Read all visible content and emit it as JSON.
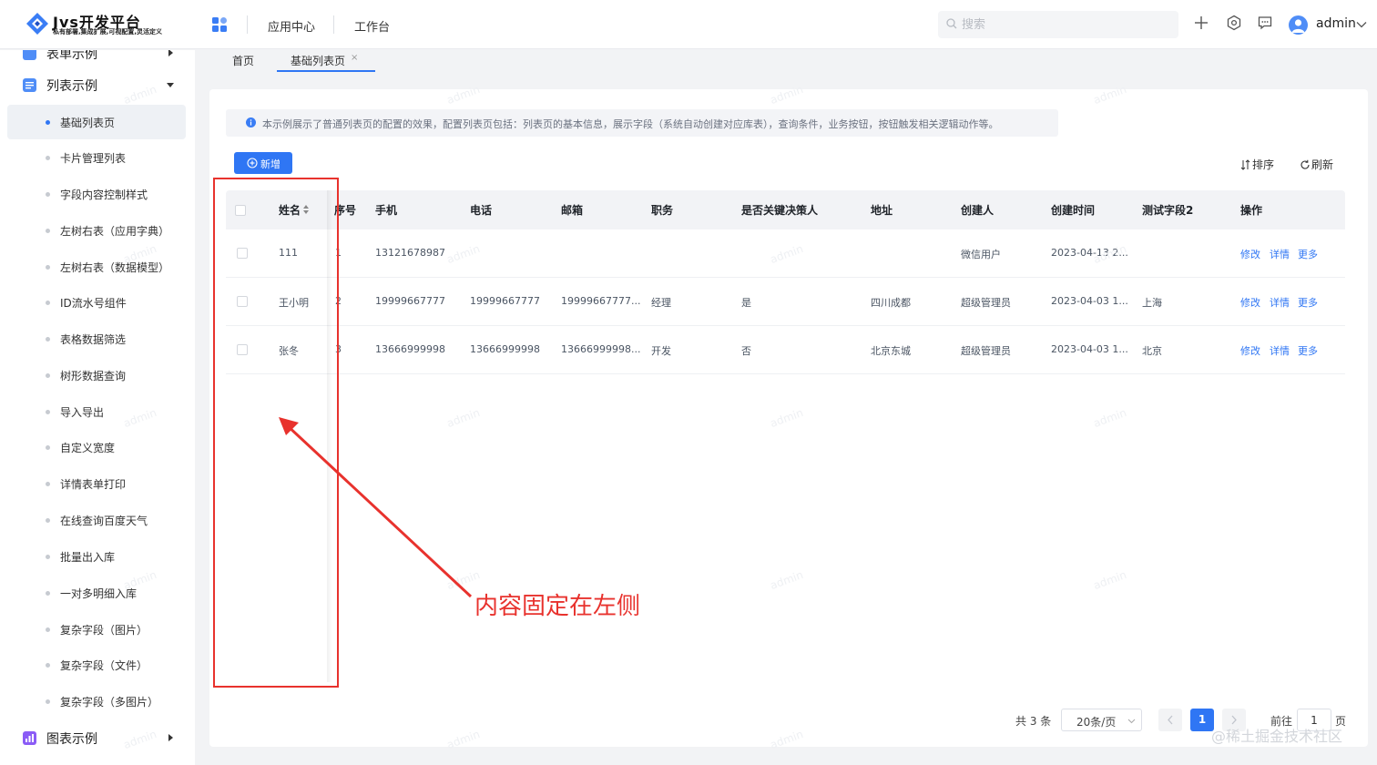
{
  "header": {
    "logo_title": "Jvs开发平台",
    "logo_subtitle": "私有部署,集成扩展,可视配置,灵活定义",
    "nav": [
      "应用中心",
      "工作台"
    ],
    "search_placeholder": "搜索",
    "username": "admin",
    "icons": [
      "apps-grid-icon",
      "plus-icon",
      "settings-icon",
      "message-icon",
      "user-avatar-icon",
      "chevron-down-icon"
    ]
  },
  "sidebar": {
    "groups": [
      {
        "label": "表单示例",
        "icon": "form-icon",
        "expanded": false
      },
      {
        "label": "列表示例",
        "icon": "list-icon",
        "expanded": true
      },
      {
        "label": "图表示例",
        "icon": "chart-icon",
        "expanded": false
      }
    ],
    "items": [
      {
        "label": "基础列表页",
        "active": true
      },
      {
        "label": "卡片管理列表"
      },
      {
        "label": "字段内容控制样式"
      },
      {
        "label": "左树右表（应用字典）"
      },
      {
        "label": "左树右表（数据模型）"
      },
      {
        "label": "ID流水号组件"
      },
      {
        "label": "表格数据筛选"
      },
      {
        "label": "树形数据查询"
      },
      {
        "label": "导入导出"
      },
      {
        "label": "自定义宽度"
      },
      {
        "label": "详情表单打印"
      },
      {
        "label": "在线查询百度天气"
      },
      {
        "label": "批量出入库"
      },
      {
        "label": "一对多明细入库"
      },
      {
        "label": "复杂字段（图片）"
      },
      {
        "label": "复杂字段（文件）"
      },
      {
        "label": "复杂字段（多图片）"
      }
    ]
  },
  "tabs": [
    {
      "label": "首页",
      "active": false
    },
    {
      "label": "基础列表页",
      "active": true,
      "closable": true
    }
  ],
  "notice": "本示例展示了普通列表页的配置的效果，配置列表页包括：列表页的基本信息，展示字段（系统自动创建对应库表），查询条件，业务按钮，按钮触发相关逻辑动作等。",
  "toolbar": {
    "new_label": "新增",
    "sort_label": "排序",
    "refresh_label": "刷新"
  },
  "table": {
    "columns": [
      "姓名",
      "序号",
      "手机",
      "电话",
      "邮箱",
      "职务",
      "是否关键决策人",
      "地址",
      "创建人",
      "创建时间",
      "测试字段2",
      "操作"
    ],
    "rows": [
      {
        "name": "111",
        "index": "1",
        "mobile": "13121678987",
        "phone": "",
        "email": "",
        "title": "",
        "key_decision": "",
        "address": "",
        "creator": "微信用户",
        "created": "2023-04-13 2...",
        "test2": ""
      },
      {
        "name": "王小明",
        "index": "2",
        "mobile": "19999667777",
        "phone": "19999667777",
        "email": "19999667777...",
        "title": "经理",
        "key_decision": "是",
        "address": "四川成都",
        "creator": "超级管理员",
        "created": "2023-04-03 1...",
        "test2": "上海"
      },
      {
        "name": "张冬",
        "index": "3",
        "mobile": "13666999998",
        "phone": "13666999998",
        "email": "13666999998...",
        "title": "开发",
        "key_decision": "否",
        "address": "北京东城",
        "creator": "超级管理员",
        "created": "2023-04-03 1...",
        "test2": "北京"
      }
    ],
    "actions": [
      "修改",
      "详情",
      "更多"
    ]
  },
  "pagination": {
    "total": "共 3 条",
    "page_size": "20条/页",
    "current": "1",
    "goto_label": "前往",
    "goto_value": "1",
    "page_suffix": "页"
  },
  "annotation": {
    "text": "内容固定在左侧",
    "color": "#e8322d"
  },
  "watermark": "admin",
  "source_watermark": "@稀土掘金技术社区",
  "colors": {
    "primary": "#2f76f4",
    "annotation": "#e8322d"
  }
}
